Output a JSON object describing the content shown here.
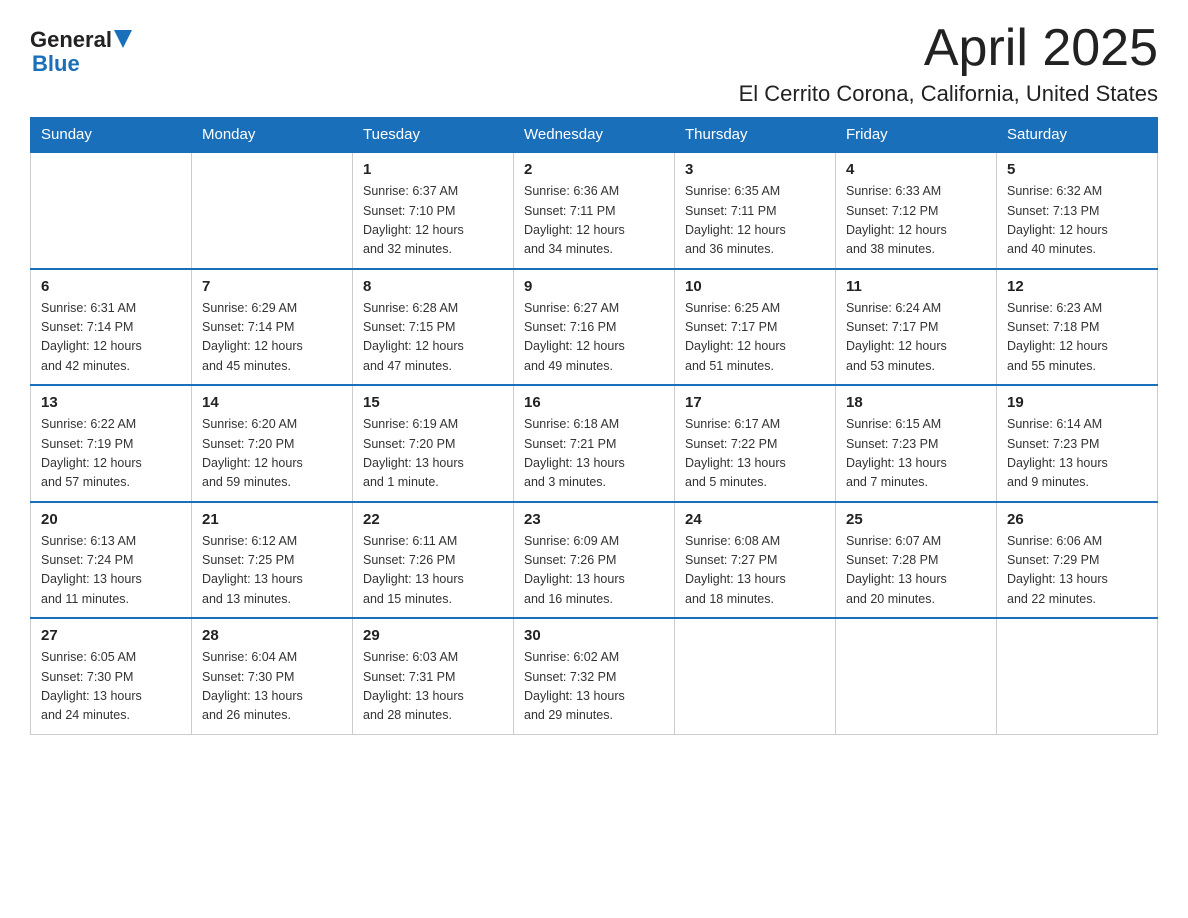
{
  "header": {
    "logo_general": "General",
    "logo_blue": "Blue",
    "month_title": "April 2025",
    "location": "El Cerrito Corona, California, United States"
  },
  "days_of_week": [
    "Sunday",
    "Monday",
    "Tuesday",
    "Wednesday",
    "Thursday",
    "Friday",
    "Saturday"
  ],
  "weeks": [
    [
      {
        "day": "",
        "info": ""
      },
      {
        "day": "",
        "info": ""
      },
      {
        "day": "1",
        "info": "Sunrise: 6:37 AM\nSunset: 7:10 PM\nDaylight: 12 hours\nand 32 minutes."
      },
      {
        "day": "2",
        "info": "Sunrise: 6:36 AM\nSunset: 7:11 PM\nDaylight: 12 hours\nand 34 minutes."
      },
      {
        "day": "3",
        "info": "Sunrise: 6:35 AM\nSunset: 7:11 PM\nDaylight: 12 hours\nand 36 minutes."
      },
      {
        "day": "4",
        "info": "Sunrise: 6:33 AM\nSunset: 7:12 PM\nDaylight: 12 hours\nand 38 minutes."
      },
      {
        "day": "5",
        "info": "Sunrise: 6:32 AM\nSunset: 7:13 PM\nDaylight: 12 hours\nand 40 minutes."
      }
    ],
    [
      {
        "day": "6",
        "info": "Sunrise: 6:31 AM\nSunset: 7:14 PM\nDaylight: 12 hours\nand 42 minutes."
      },
      {
        "day": "7",
        "info": "Sunrise: 6:29 AM\nSunset: 7:14 PM\nDaylight: 12 hours\nand 45 minutes."
      },
      {
        "day": "8",
        "info": "Sunrise: 6:28 AM\nSunset: 7:15 PM\nDaylight: 12 hours\nand 47 minutes."
      },
      {
        "day": "9",
        "info": "Sunrise: 6:27 AM\nSunset: 7:16 PM\nDaylight: 12 hours\nand 49 minutes."
      },
      {
        "day": "10",
        "info": "Sunrise: 6:25 AM\nSunset: 7:17 PM\nDaylight: 12 hours\nand 51 minutes."
      },
      {
        "day": "11",
        "info": "Sunrise: 6:24 AM\nSunset: 7:17 PM\nDaylight: 12 hours\nand 53 minutes."
      },
      {
        "day": "12",
        "info": "Sunrise: 6:23 AM\nSunset: 7:18 PM\nDaylight: 12 hours\nand 55 minutes."
      }
    ],
    [
      {
        "day": "13",
        "info": "Sunrise: 6:22 AM\nSunset: 7:19 PM\nDaylight: 12 hours\nand 57 minutes."
      },
      {
        "day": "14",
        "info": "Sunrise: 6:20 AM\nSunset: 7:20 PM\nDaylight: 12 hours\nand 59 minutes."
      },
      {
        "day": "15",
        "info": "Sunrise: 6:19 AM\nSunset: 7:20 PM\nDaylight: 13 hours\nand 1 minute."
      },
      {
        "day": "16",
        "info": "Sunrise: 6:18 AM\nSunset: 7:21 PM\nDaylight: 13 hours\nand 3 minutes."
      },
      {
        "day": "17",
        "info": "Sunrise: 6:17 AM\nSunset: 7:22 PM\nDaylight: 13 hours\nand 5 minutes."
      },
      {
        "day": "18",
        "info": "Sunrise: 6:15 AM\nSunset: 7:23 PM\nDaylight: 13 hours\nand 7 minutes."
      },
      {
        "day": "19",
        "info": "Sunrise: 6:14 AM\nSunset: 7:23 PM\nDaylight: 13 hours\nand 9 minutes."
      }
    ],
    [
      {
        "day": "20",
        "info": "Sunrise: 6:13 AM\nSunset: 7:24 PM\nDaylight: 13 hours\nand 11 minutes."
      },
      {
        "day": "21",
        "info": "Sunrise: 6:12 AM\nSunset: 7:25 PM\nDaylight: 13 hours\nand 13 minutes."
      },
      {
        "day": "22",
        "info": "Sunrise: 6:11 AM\nSunset: 7:26 PM\nDaylight: 13 hours\nand 15 minutes."
      },
      {
        "day": "23",
        "info": "Sunrise: 6:09 AM\nSunset: 7:26 PM\nDaylight: 13 hours\nand 16 minutes."
      },
      {
        "day": "24",
        "info": "Sunrise: 6:08 AM\nSunset: 7:27 PM\nDaylight: 13 hours\nand 18 minutes."
      },
      {
        "day": "25",
        "info": "Sunrise: 6:07 AM\nSunset: 7:28 PM\nDaylight: 13 hours\nand 20 minutes."
      },
      {
        "day": "26",
        "info": "Sunrise: 6:06 AM\nSunset: 7:29 PM\nDaylight: 13 hours\nand 22 minutes."
      }
    ],
    [
      {
        "day": "27",
        "info": "Sunrise: 6:05 AM\nSunset: 7:30 PM\nDaylight: 13 hours\nand 24 minutes."
      },
      {
        "day": "28",
        "info": "Sunrise: 6:04 AM\nSunset: 7:30 PM\nDaylight: 13 hours\nand 26 minutes."
      },
      {
        "day": "29",
        "info": "Sunrise: 6:03 AM\nSunset: 7:31 PM\nDaylight: 13 hours\nand 28 minutes."
      },
      {
        "day": "30",
        "info": "Sunrise: 6:02 AM\nSunset: 7:32 PM\nDaylight: 13 hours\nand 29 minutes."
      },
      {
        "day": "",
        "info": ""
      },
      {
        "day": "",
        "info": ""
      },
      {
        "day": "",
        "info": ""
      }
    ]
  ],
  "colors": {
    "header_bg": "#1a6fba",
    "header_text": "#ffffff",
    "border": "#1a6fba",
    "cell_border": "#cccccc"
  }
}
